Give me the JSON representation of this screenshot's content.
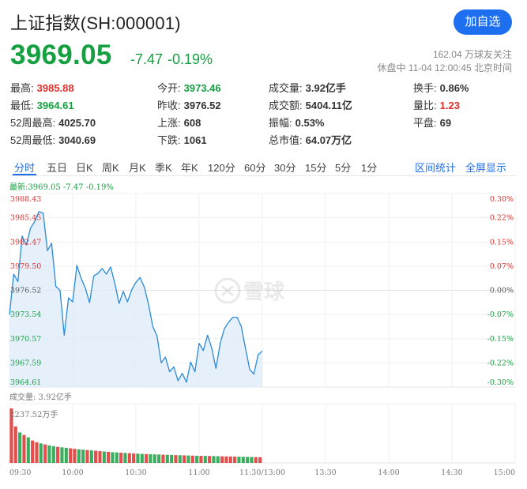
{
  "header": {
    "title": "上证指数(SH:000001)",
    "follow_button": "加自选",
    "price": "3969.05",
    "change": "-7.47",
    "change_pct": "-0.19%",
    "followers": "162.04 万球友关注",
    "status": "休盘中 11-04 12:00:45 北京时间"
  },
  "quote": {
    "high": {
      "label": "最高:",
      "value": "3985.88"
    },
    "low": {
      "label": "最低:",
      "value": "3964.61"
    },
    "high52": {
      "label": "52周最高:",
      "value": "4025.70"
    },
    "low52": {
      "label": "52周最低:",
      "value": "3040.69"
    },
    "open": {
      "label": "今开:",
      "value": "3973.46"
    },
    "prev_close": {
      "label": "昨收:",
      "value": "3976.52"
    },
    "up": {
      "label": "上涨:",
      "value": "608"
    },
    "down": {
      "label": "下跌:",
      "value": "1061"
    },
    "volume": {
      "label": "成交量:",
      "value": "3.92亿手"
    },
    "amount": {
      "label": "成交额:",
      "value": "5404.11亿"
    },
    "amplitude": {
      "label": "振幅:",
      "value": "0.53%"
    },
    "market_cap": {
      "label": "总市值:",
      "value": "64.07万亿"
    },
    "turnover": {
      "label": "换手:",
      "value": "0.86%"
    },
    "volume_ratio": {
      "label": "量比:",
      "value": "1.23"
    },
    "flat": {
      "label": "平盘:",
      "value": "69"
    }
  },
  "tabs": [
    "分时",
    "五日",
    "日K",
    "周K",
    "月K",
    "季K",
    "年K",
    "120分",
    "60分",
    "30分",
    "15分",
    "5分",
    "1分"
  ],
  "tab_actions": [
    "区间统计",
    "全屏显示"
  ],
  "chart_info": {
    "latest": "最新:3969.05 -7.47 -0.19%",
    "volume_label": "成交量: 3.92亿手",
    "volume_max": "2237.52万手"
  },
  "colors": {
    "up": "#e0302c",
    "down": "#17a042",
    "accent": "#1e6ff0",
    "line": "#2a8ad8"
  },
  "chart_data": {
    "type": "line",
    "title": "",
    "prev_close": 3976.52,
    "y_ticks_left": [
      "3988.43",
      "3985.45",
      "3982.47",
      "3979.50",
      "3976.52",
      "3973.54",
      "3970.57",
      "3967.59",
      "3964.61"
    ],
    "y_ticks_right": [
      "0.30%",
      "0.22%",
      "0.15%",
      "0.07%",
      "0.00%",
      "-0.07%",
      "-0.15%",
      "-0.22%",
      "-0.30%"
    ],
    "ylim": [
      3964.61,
      3988.43
    ],
    "x_ticks": [
      "09:30",
      "10:00",
      "10:30",
      "11:00",
      "11:30/13:00",
      "13:30",
      "14:00",
      "14:30",
      "15:00"
    ],
    "session_minutes": 240,
    "price_minutes": [
      0,
      2,
      4,
      6,
      8,
      10,
      12,
      14,
      16,
      18,
      20,
      22,
      24,
      26,
      28,
      30,
      32,
      34,
      36,
      38,
      40,
      42,
      44,
      46,
      48,
      50,
      52,
      54,
      56,
      58,
      60,
      62,
      64,
      66,
      68,
      70,
      72,
      74,
      76,
      78,
      80,
      82,
      84,
      86,
      88,
      90,
      92,
      94,
      96,
      98,
      100,
      102,
      104,
      106,
      108,
      110,
      112,
      114,
      116,
      118,
      120
    ],
    "price_values": [
      3973.5,
      3978.5,
      3977.6,
      3983.2,
      3982.1,
      3984.2,
      3985.0,
      3986.2,
      3986.0,
      3981.4,
      3982.3,
      3977.0,
      3976.5,
      3971.0,
      3975.6,
      3975.1,
      3979.6,
      3978.0,
      3976.8,
      3975.0,
      3978.3,
      3978.6,
      3979.2,
      3978.5,
      3979.4,
      3977.4,
      3974.9,
      3976.4,
      3975.1,
      3976.6,
      3977.5,
      3978.1,
      3976.9,
      3974.8,
      3972.1,
      3970.9,
      3967.6,
      3968.3,
      3966.5,
      3967.1,
      3965.4,
      3966.3,
      3965.2,
      3967.7,
      3966.5,
      3970.0,
      3969.1,
      3971.0,
      3969.4,
      3966.9,
      3970.0,
      3971.8,
      3972.6,
      3973.2,
      3973.2,
      3972.1,
      3969.4,
      3966.8,
      3966.2,
      3968.6,
      3969.05
    ],
    "volume_unit": "万手",
    "volume_values": [
      2237.52,
      1500,
      1250,
      1150,
      1050,
      920,
      850,
      800,
      760,
      720,
      690,
      660,
      640,
      620,
      600,
      580,
      560,
      545,
      530,
      515,
      500,
      485,
      470,
      455,
      440,
      430,
      420,
      410,
      400,
      390,
      380,
      372,
      365,
      358,
      350,
      344,
      338,
      332,
      326,
      320,
      315,
      310,
      305,
      300,
      296,
      292,
      288,
      284,
      280,
      276,
      272,
      268,
      264,
      260,
      256,
      252,
      248,
      244,
      240,
      236
    ],
    "volume_directions": [
      "up",
      "up",
      "down",
      "up",
      "down",
      "up",
      "up",
      "down",
      "up",
      "down",
      "down",
      "up",
      "down",
      "down",
      "up",
      "up",
      "down",
      "down",
      "up",
      "down",
      "up",
      "up",
      "down",
      "up",
      "down",
      "down",
      "up",
      "down",
      "up",
      "up",
      "down",
      "down",
      "up",
      "down",
      "down",
      "down",
      "up",
      "down",
      "down",
      "up",
      "down",
      "up",
      "down",
      "up",
      "down",
      "up",
      "down",
      "up",
      "down",
      "down",
      "up",
      "up",
      "up",
      "up",
      "down",
      "down",
      "down",
      "down",
      "up",
      "up"
    ]
  }
}
